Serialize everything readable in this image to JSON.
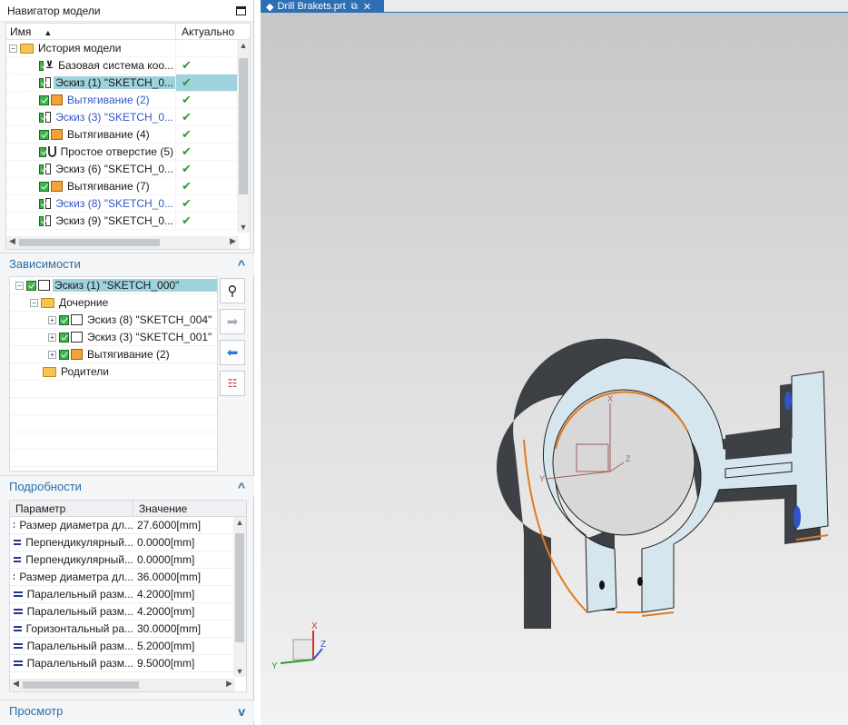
{
  "navigator": {
    "title": "Навигатор модели",
    "col_name": "Имя",
    "col_status": "Актуально",
    "root": "История модели",
    "items": [
      {
        "label": "Базовая система коо...",
        "icon": "csys",
        "selected": false,
        "blue": false
      },
      {
        "label": "Эскиз (1) \"SKETCH_0...",
        "icon": "sketch",
        "selected": true,
        "blue": false
      },
      {
        "label": "Вытягивание (2)",
        "icon": "extrude",
        "selected": false,
        "blue": true
      },
      {
        "label": "Эскиз (3) \"SKETCH_0...",
        "icon": "sketch",
        "selected": false,
        "blue": true
      },
      {
        "label": "Вытягивание (4)",
        "icon": "extrude",
        "selected": false,
        "blue": false
      },
      {
        "label": "Простое отверстие (5)",
        "icon": "hole",
        "selected": false,
        "blue": false
      },
      {
        "label": "Эскиз (6) \"SKETCH_0...",
        "icon": "sketch",
        "selected": false,
        "blue": false
      },
      {
        "label": "Вытягивание (7)",
        "icon": "extrude",
        "selected": false,
        "blue": false
      },
      {
        "label": "Эскиз (8) \"SKETCH_0...",
        "icon": "sketch",
        "selected": false,
        "blue": true
      },
      {
        "label": "Эскиз (9) \"SKETCH_0...",
        "icon": "sketch",
        "selected": false,
        "blue": false
      }
    ]
  },
  "dependencies": {
    "title": "Зависимости",
    "root": "Эскиз (1) \"SKETCH_000\"",
    "children_label": "Дочерние",
    "children": [
      "Эскиз (8) \"SKETCH_004\"",
      "Эскиз (3) \"SKETCH_001\"",
      "Вытягивание (2)"
    ],
    "parents_label": "Родители"
  },
  "details": {
    "title": "Подробности",
    "col_param": "Параметр",
    "col_value": "Значение",
    "rows": [
      {
        "param": "Размер диаметра дл...",
        "value": "27.6000[mm]"
      },
      {
        "param": "Перпендикулярный...",
        "value": "0.0000[mm]"
      },
      {
        "param": "Перпендикулярный...",
        "value": "0.0000[mm]"
      },
      {
        "param": "Размер диаметра дл...",
        "value": "36.0000[mm]"
      },
      {
        "param": "Паралельный разм...",
        "value": "4.2000[mm]"
      },
      {
        "param": "Паралельный разм...",
        "value": "4.2000[mm]"
      },
      {
        "param": "Горизонтальный ра...",
        "value": "30.0000[mm]"
      },
      {
        "param": "Паралельный разм...",
        "value": "5.2000[mm]"
      },
      {
        "param": "Паралельный разм...",
        "value": "9.5000[mm]"
      }
    ]
  },
  "preview": {
    "title": "Просмотр"
  },
  "viewport": {
    "tab_title": "Drill Brakets.prt",
    "axis_x": "X",
    "axis_y": "Y",
    "axis_z": "Z"
  }
}
